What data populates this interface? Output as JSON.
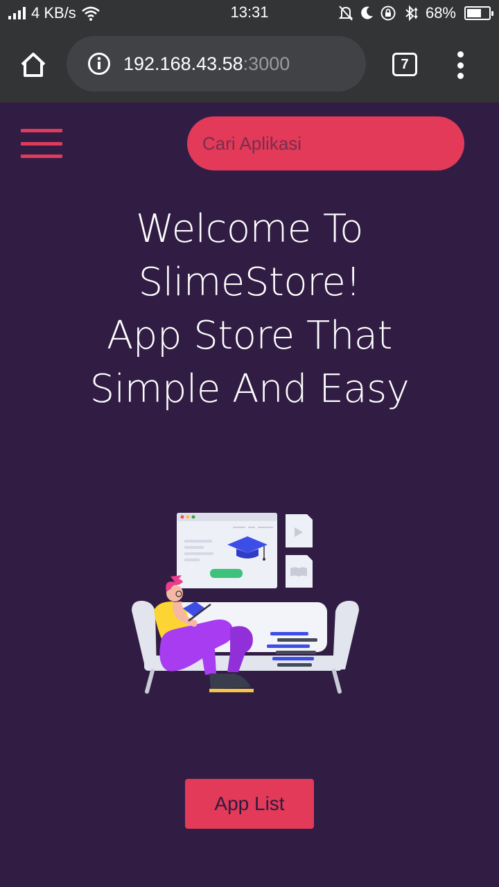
{
  "status_bar": {
    "network_speed": "4 KB/s",
    "time": "13:31",
    "battery_percent": "68%",
    "battery_level": 0.68,
    "icons": [
      "signal-icon",
      "wifi-icon",
      "mute-icon",
      "moon-icon",
      "lock-rotation-icon",
      "bluetooth-icon",
      "battery-icon"
    ]
  },
  "browser": {
    "url_host": "192.168.43.58",
    "url_port": ":3000",
    "tab_count": "7",
    "icons": [
      "home-icon",
      "info-icon",
      "tabs-icon",
      "overflow-menu-icon"
    ]
  },
  "header": {
    "menu_icon": "hamburger-menu-icon",
    "search_placeholder": "Cari Aplikasi"
  },
  "hero": {
    "lines": [
      "Welcome To",
      "SlimeStore!",
      "App Store That",
      "Simple And Easy"
    ]
  },
  "cta": {
    "label": "App List"
  },
  "colors": {
    "background": "#311d43",
    "accent": "#e23a58",
    "browser_chrome": "#333436"
  }
}
